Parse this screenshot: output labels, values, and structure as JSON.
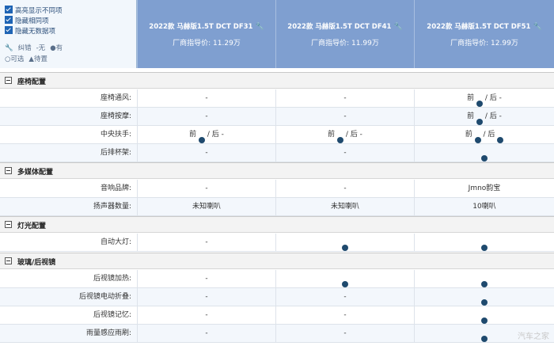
{
  "options": {
    "items": [
      {
        "label": "高亮显示不同项"
      },
      {
        "label": "隐藏相同项"
      },
      {
        "label": "隐藏无数据项"
      }
    ],
    "legend1": [
      "纠错",
      "-无",
      "●有"
    ],
    "legend2": [
      "○可选",
      "▲待置"
    ]
  },
  "cars": [
    {
      "name": "2022款 马赫版1.5T DCT DF31",
      "price": "厂商指导价: 11.29万"
    },
    {
      "name": "2022款 马赫版1.5T DCT DF41",
      "price": "厂商指导价: 11.99万"
    },
    {
      "name": "2022款 马赫版1.5T DCT DF51",
      "price": "厂商指导价: 12.99万"
    }
  ],
  "sections": [
    {
      "title": "座椅配置",
      "rows": [
        {
          "label": "座椅通风:",
          "values": [
            "-",
            "-",
            "前 ● / 后 -"
          ]
        },
        {
          "label": "座椅按摩:",
          "values": [
            "-",
            "-",
            "前 ● / 后 -"
          ]
        },
        {
          "label": "中央扶手:",
          "values": [
            "前 ● / 后 -",
            "前 ● / 后 -",
            "前 ● / 后 ●"
          ]
        },
        {
          "label": "后排杯架:",
          "values": [
            "-",
            "-",
            "●"
          ]
        }
      ]
    },
    {
      "title": "多媒体配置",
      "rows": [
        {
          "label": "音响品牌:",
          "values": [
            "-",
            "-",
            "Jmno韵宝"
          ]
        },
        {
          "label": "扬声器数量:",
          "values": [
            "未知喇叭",
            "未知喇叭",
            "10喇叭"
          ]
        }
      ]
    },
    {
      "title": "灯光配置",
      "rows": [
        {
          "label": "自动大灯:",
          "values": [
            "-",
            "●",
            "●"
          ]
        }
      ]
    },
    {
      "title": "玻璃/后视镜",
      "rows": [
        {
          "label": "后视镜加热:",
          "values": [
            "-",
            "●",
            "●"
          ]
        },
        {
          "label": "后视镜电动折叠:",
          "values": [
            "-",
            "-",
            "●"
          ]
        },
        {
          "label": "后视镜记忆:",
          "values": [
            "-",
            "-",
            "●"
          ]
        },
        {
          "label": "雨量感应雨刷:",
          "values": [
            "-",
            "-",
            "●"
          ]
        }
      ]
    }
  ],
  "watermark": "汽车之家"
}
